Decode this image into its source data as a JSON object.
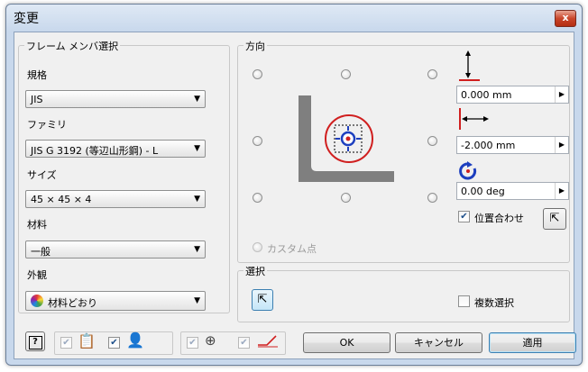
{
  "window": {
    "title": "変更",
    "close_label": "x"
  },
  "frame_member": {
    "group_label": "フレーム メンバ選択",
    "standard": {
      "label": "規格",
      "value": "JIS"
    },
    "family": {
      "label": "ファミリ",
      "value": "JIS G 3192 (等辺山形鋼) - L"
    },
    "size": {
      "label": "サイズ",
      "value": "45 × 45 × 4"
    },
    "material": {
      "label": "材料",
      "value": "一般"
    },
    "appearance": {
      "label": "外観",
      "value": "材料どおり"
    }
  },
  "orientation": {
    "group_label": "方向",
    "custom_point_label": "カスタム点",
    "vertical_offset": "0.000 mm",
    "horizontal_offset": "-2.000 mm",
    "rotation": "0.00 deg",
    "align_label": "位置合わせ",
    "align_checked": true
  },
  "selection": {
    "group_label": "選択",
    "multi_select_label": "複数選択",
    "multi_select_checked": false
  },
  "footer": {
    "ok_label": "OK",
    "cancel_label": "キャンセル",
    "apply_label": "適用"
  },
  "colors": {
    "accent_red": "#d01f1f",
    "accent_blue": "#1d3fbf",
    "profile_gray": "#7f7f7f"
  }
}
